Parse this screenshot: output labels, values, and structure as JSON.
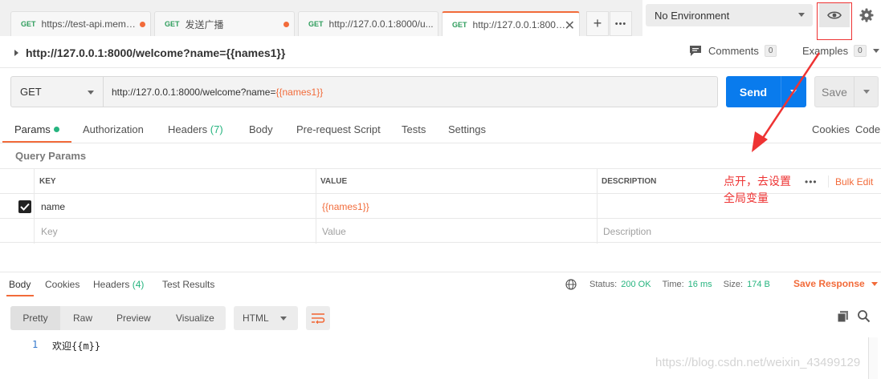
{
  "tabs": [
    {
      "method": "GET",
      "name": "https://test-api.meme...",
      "unsaved": true,
      "active": false
    },
    {
      "method": "GET",
      "name": "发送广播",
      "unsaved": true,
      "active": false
    },
    {
      "method": "GET",
      "name": "http://127.0.0.1:8000/u...",
      "unsaved": false,
      "active": false
    },
    {
      "method": "GET",
      "name": "http://127.0.0.1:8000/w...",
      "unsaved": false,
      "active": true
    }
  ],
  "tab_actions": {
    "add": "+",
    "more": "•••"
  },
  "environment": {
    "selected": "No Environment"
  },
  "request": {
    "title": "http://127.0.0.1:8000/welcome?name={{names1}}",
    "comments_label": "Comments",
    "comments_count": "0",
    "examples_label": "Examples",
    "examples_count": "0",
    "method": "GET",
    "url_base": "http://127.0.0.1:8000/welcome?name=",
    "url_var": "{{names1}}",
    "send_label": "Send",
    "save_label": "Save"
  },
  "request_tabs": {
    "params": "Params",
    "authorization": "Authorization",
    "headers": "Headers",
    "headers_count": "(7)",
    "body": "Body",
    "prerequest": "Pre-request Script",
    "tests": "Tests",
    "settings": "Settings",
    "cookies": "Cookies",
    "code": "Code"
  },
  "query_params": {
    "label": "Query Params",
    "columns": {
      "key": "KEY",
      "value": "VALUE",
      "description": "DESCRIPTION"
    },
    "more": "•••",
    "bulk_edit": "Bulk Edit",
    "rows": [
      {
        "checked": true,
        "key": "name",
        "value": "{{names1}}",
        "description": ""
      }
    ],
    "placeholders": {
      "key": "Key",
      "value": "Value",
      "description": "Description"
    }
  },
  "annotation": {
    "line1": "点开，去设置",
    "line2": "全局变量",
    "color": "#e33333"
  },
  "response": {
    "tabs": {
      "body": "Body",
      "cookies": "Cookies",
      "headers": "Headers",
      "headers_count": "(4)",
      "test_results": "Test Results"
    },
    "status_label": "Status:",
    "status_value": "200 OK",
    "time_label": "Time:",
    "time_value": "16 ms",
    "size_label": "Size:",
    "size_value": "174 B",
    "save_response": "Save Response",
    "formats": {
      "pretty": "Pretty",
      "raw": "Raw",
      "preview": "Preview",
      "visualize": "Visualize"
    },
    "language": "HTML",
    "code": [
      {
        "line": "1",
        "text": "欢迎{{m}}"
      }
    ]
  },
  "watermark": "https://blog.csdn.net/weixin_43499129",
  "colors": {
    "accent": "#f26b3a",
    "send": "#097bed",
    "success": "#26b47f"
  }
}
